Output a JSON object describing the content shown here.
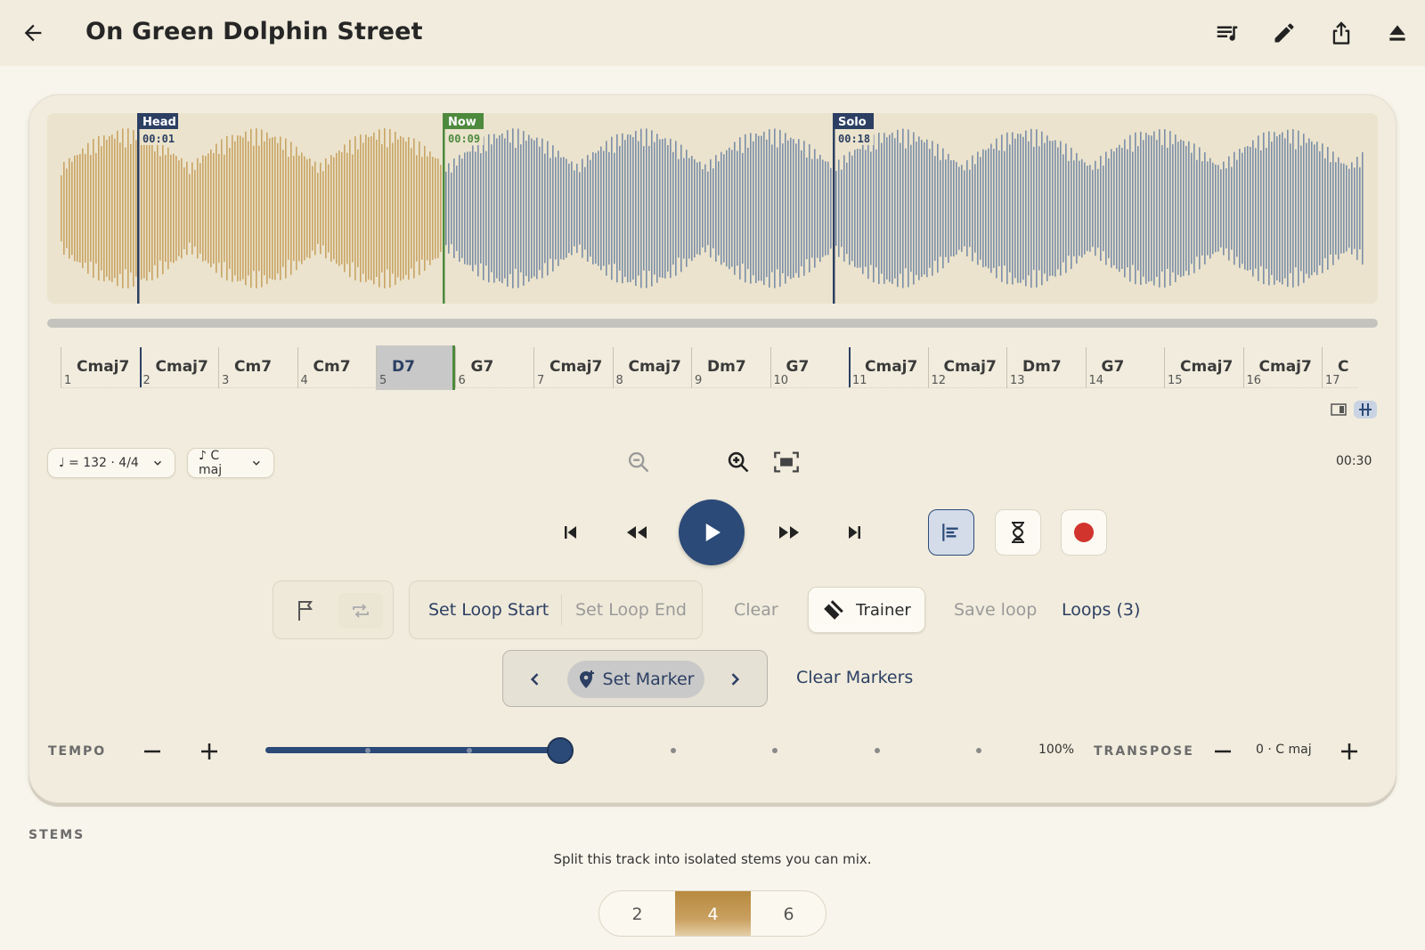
{
  "header": {
    "title": "On Green Dolphin Street",
    "actions": [
      "queue-music-icon",
      "edit-icon",
      "share-icon",
      "eject-icon"
    ]
  },
  "waveform": {
    "played_color": "#c9a464",
    "remaining_color": "#7b8fa8",
    "markers": [
      {
        "label": "Head",
        "time": "00:01",
        "color": "#2c3f63"
      },
      {
        "label": "Now",
        "time": "00:09",
        "color": "#4d8a3e"
      },
      {
        "label": "Solo",
        "time": "00:18",
        "color": "#2c3f63"
      }
    ]
  },
  "chords": [
    {
      "name": "Cmaj7",
      "num": "1"
    },
    {
      "name": "Cmaj7",
      "num": "2"
    },
    {
      "name": "Cm7",
      "num": "3"
    },
    {
      "name": "Cm7",
      "num": "4"
    },
    {
      "name": "D7",
      "num": "5"
    },
    {
      "name": "G7",
      "num": "6"
    },
    {
      "name": "Cmaj7",
      "num": "7"
    },
    {
      "name": "Cmaj7",
      "num": "8"
    },
    {
      "name": "Dm7",
      "num": "9"
    },
    {
      "name": "G7",
      "num": "10"
    },
    {
      "name": "Cmaj7",
      "num": "11"
    },
    {
      "name": "Cmaj7",
      "num": "12"
    },
    {
      "name": "Dm7",
      "num": "13"
    },
    {
      "name": "G7",
      "num": "14"
    },
    {
      "name": "Cmaj7",
      "num": "15"
    },
    {
      "name": "Cmaj7",
      "num": "16"
    },
    {
      "name": "C",
      "num": "17"
    }
  ],
  "controls": {
    "tempo_pill": "♩ = 132 · 4/4",
    "key_pill": "♪ C maj",
    "total_time": "00:30"
  },
  "loop": {
    "set_start": "Set Loop Start",
    "set_end": "Set Loop End",
    "clear": "Clear",
    "trainer": "Trainer",
    "save": "Save loop",
    "loops": "Loops (3)"
  },
  "markers": {
    "set_marker": "Set Marker",
    "clear_markers": "Clear Markers"
  },
  "tempo": {
    "label": "TEMPO",
    "value": "100%",
    "slider_fraction": 0.41
  },
  "transpose": {
    "label": "TRANSPOSE",
    "value": "0 · C maj"
  },
  "stems": {
    "label": "STEMS",
    "subtitle": "Split this track into isolated stems you can mix.",
    "options": [
      "2",
      "4",
      "6"
    ],
    "selected": "4"
  },
  "colors": {
    "accent": "#2c4a78",
    "record": "#d0342c",
    "gold": "#b78a3f"
  }
}
